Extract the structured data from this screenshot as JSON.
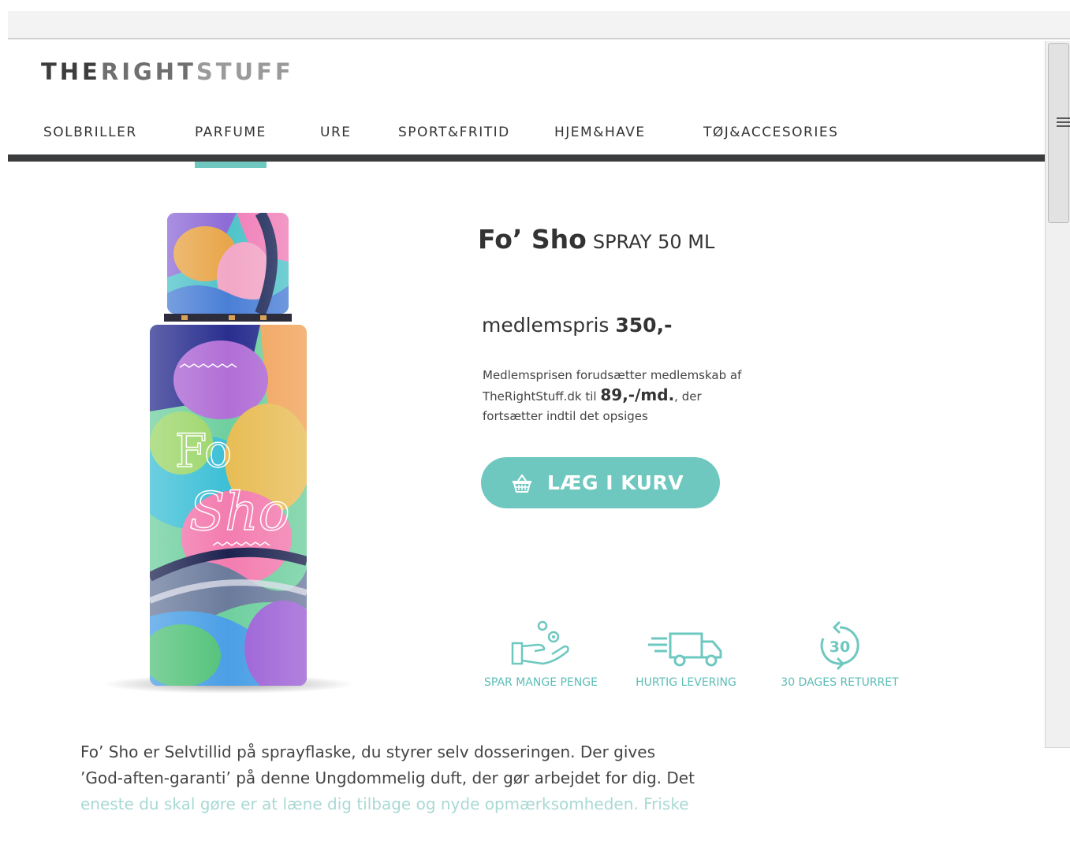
{
  "logo": {
    "part1": "THE",
    "part2": "RIGHT",
    "part3": "STUFF"
  },
  "nav": {
    "items": [
      {
        "label": "SOLBRILLER"
      },
      {
        "label": "PARFUME"
      },
      {
        "label": "URE"
      },
      {
        "label": "SPORT&FRITID"
      },
      {
        "label": "HJEM&HAVE"
      },
      {
        "label": "TØJ&ACCESORIES"
      }
    ],
    "active_index": 1
  },
  "product": {
    "name": "Fo’ Sho",
    "size": "SPRAY 50 ML",
    "price_label": "medlemspris",
    "price_value": "350,-",
    "member_note_pre": "Medlemsprisen forudsætter medlemskab af TheRightStuff.dk til ",
    "member_note_price": "89,-/md.",
    "member_note_post": ", der fortsætter indtil det opsiges",
    "bottle_text": "Fo’ Sho"
  },
  "cart_button": {
    "label": "LÆG I KURV",
    "icon": "basket-icon"
  },
  "features": [
    {
      "label": "SPAR MANGE PENGE",
      "icon": "hand-coins-icon"
    },
    {
      "label": "HURTIG LEVERING",
      "icon": "fast-truck-icon"
    },
    {
      "label": "30 DAGES RETURRET",
      "icon": "return-30-icon"
    }
  ],
  "description": {
    "line1": "Fo’ Sho er Selvtillid på sprayflaske, du styrer selv dosseringen. Der gives",
    "line2": "’God-aften-garanti’ på denne Ungdommelig duft, der gør arbejdet for dig. Det",
    "line3": "eneste du skal gøre er at læne dig tilbage og nyde opmærksomheden. Friske"
  },
  "colors": {
    "accent": "#6ec8c0",
    "nav_bar": "#3b3c3d",
    "text": "#333333"
  }
}
